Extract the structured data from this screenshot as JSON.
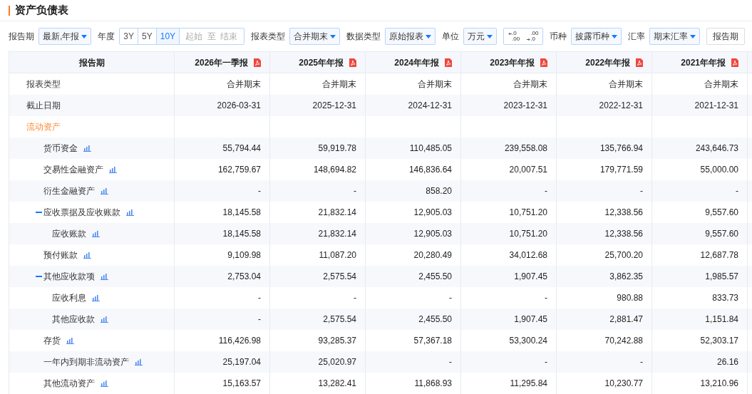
{
  "title": "资产负债表",
  "filters": [
    {
      "kind": "select",
      "label": "报告期",
      "value": "最新,年报"
    },
    {
      "kind": "range",
      "label": "年度",
      "options": [
        {
          "label": "3Y",
          "selected": false
        },
        {
          "label": "5Y",
          "selected": false
        },
        {
          "label": "10Y",
          "selected": true
        }
      ],
      "start_placeholder": "起始",
      "separator": "至",
      "end_placeholder": "结束"
    },
    {
      "kind": "select",
      "label": "报表类型",
      "value": "合并期末"
    },
    {
      "kind": "select",
      "label": "数据类型",
      "value": "原始报表"
    },
    {
      "kind": "select",
      "label": "单位",
      "value": "万元"
    },
    {
      "kind": "decimals",
      "buttons": [
        {
          "top": ".0",
          "bottom": ".00",
          "kind": "decrease"
        },
        {
          "top": ".00",
          "bottom": ".0",
          "kind": "increase"
        }
      ]
    },
    {
      "kind": "select",
      "label": "币种",
      "value": "披露币种"
    },
    {
      "kind": "select",
      "label": "汇率",
      "value": "期末汇率"
    },
    {
      "kind": "button",
      "value": "报告期"
    }
  ],
  "table": {
    "corner": "报告期",
    "columns": [
      "2026年一季报",
      "2025年年报",
      "2024年年报",
      "2023年年报",
      "2022年年报",
      "2021年年报"
    ],
    "rows": [
      {
        "kind": "meta",
        "label": "报表类型",
        "values": [
          "合并期末",
          "合并期末",
          "合并期末",
          "合并期末",
          "合并期末",
          "合并期末"
        ]
      },
      {
        "kind": "meta",
        "label": "截止日期",
        "values": [
          "2026-03-31",
          "2025-12-31",
          "2024-12-31",
          "2023-12-31",
          "2022-12-31",
          "2021-12-31"
        ]
      },
      {
        "kind": "section",
        "label": "流动资产"
      },
      {
        "kind": "item",
        "label": "货币资金",
        "values": [
          "55,794.44",
          "59,919.78",
          "110,485.05",
          "239,558.08",
          "135,766.94",
          "243,646.73"
        ]
      },
      {
        "kind": "item",
        "label": "交易性金融资产",
        "values": [
          "162,759.67",
          "148,694.82",
          "146,836.64",
          "20,007.51",
          "179,771.59",
          "55,000.00"
        ]
      },
      {
        "kind": "item",
        "label": "衍生金融资产",
        "values": [
          "-",
          "-",
          "858.20",
          "-",
          "-",
          "-"
        ]
      },
      {
        "kind": "item",
        "label": "应收票据及应收账款",
        "expanded": true,
        "values": [
          "18,145.58",
          "21,832.14",
          "12,905.03",
          "10,751.20",
          "12,338.56",
          "9,557.60"
        ],
        "children": [
          {
            "kind": "item",
            "label": "应收账款",
            "values": [
              "18,145.58",
              "21,832.14",
              "12,905.03",
              "10,751.20",
              "12,338.56",
              "9,557.60"
            ]
          }
        ]
      },
      {
        "kind": "item",
        "label": "预付账款",
        "values": [
          "9,109.98",
          "11,087.20",
          "20,280.49",
          "34,012.68",
          "25,700.20",
          "12,687.78"
        ]
      },
      {
        "kind": "item",
        "label": "其他应收款项",
        "expanded": true,
        "values": [
          "2,753.04",
          "2,575.54",
          "2,455.50",
          "1,907.45",
          "3,862.35",
          "1,985.57"
        ],
        "children": [
          {
            "kind": "item",
            "label": "应收利息",
            "values": [
              "-",
              "-",
              "-",
              "-",
              "980.88",
              "833.73"
            ]
          },
          {
            "kind": "item",
            "label": "其他应收款",
            "values": [
              "-",
              "2,575.54",
              "2,455.50",
              "1,907.45",
              "2,881.47",
              "1,151.84"
            ]
          }
        ]
      },
      {
        "kind": "item",
        "label": "存货",
        "values": [
          "116,426.98",
          "93,285.37",
          "57,367.18",
          "53,300.24",
          "70,242.88",
          "52,303.17"
        ]
      },
      {
        "kind": "item",
        "label": "一年内到期非流动资产",
        "values": [
          "25,197.04",
          "25,020.97",
          "-",
          "-",
          "-",
          "26.16"
        ]
      },
      {
        "kind": "item",
        "label": "其他流动资产",
        "values": [
          "15,163.57",
          "13,282.41",
          "11,868.93",
          "11,295.84",
          "10,230.77",
          "13,210.96"
        ]
      }
    ]
  }
}
